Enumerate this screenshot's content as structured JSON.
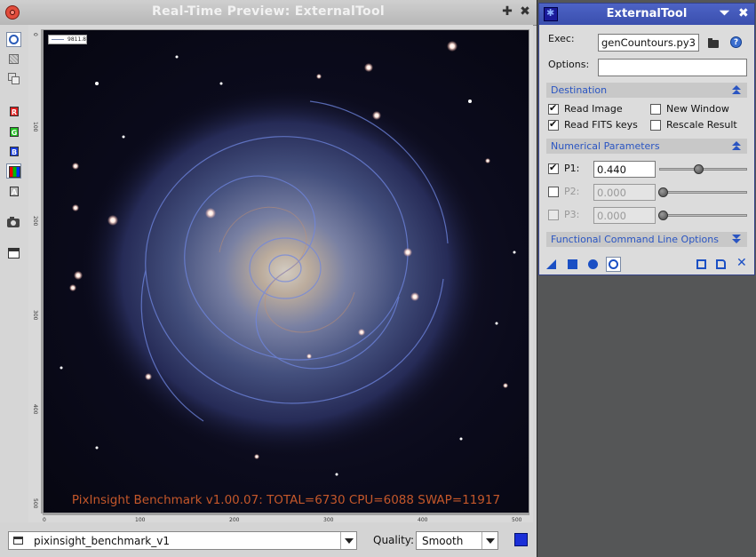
{
  "preview": {
    "title": "Real-Time Preview: ExternalTool",
    "benchmark_text": "PixInsight Benchmark v1.00.07: TOTAL=6730 CPU=6088 SWAP=11917",
    "contour_legend": "9811.8",
    "ruler_left": [
      "0",
      "100",
      "200",
      "300",
      "400",
      "500"
    ],
    "ruler_bottom": [
      "0",
      "100",
      "200",
      "300",
      "400",
      "500"
    ],
    "view_selector": "pixinsight_benchmark_v1",
    "quality_label": "Quality:",
    "quality_value": "Smooth",
    "tools": [
      "readout-mode",
      "zoom-mode",
      "pan-mode",
      "R",
      "G",
      "B",
      "rgb",
      "A",
      "snapshot",
      "new-window"
    ]
  },
  "panel": {
    "title": "ExternalTool",
    "exec_label": "Exec:",
    "exec_value": "genCountours.py3",
    "options_label": "Options:",
    "options_value": "",
    "destination": {
      "title": "Destination",
      "read_image": "Read Image",
      "read_image_checked": true,
      "new_window": "New Window",
      "new_window_checked": false,
      "read_fits": "Read FITS keys",
      "read_fits_checked": true,
      "rescale": "Rescale Result",
      "rescale_checked": false
    },
    "numerical": {
      "title": "Numerical Parameters",
      "p1_label": "P1:",
      "p1_value": "0.440",
      "p1_checked": true,
      "p1_slider": 0.44,
      "p2_label": "P2:",
      "p2_value": "0.000",
      "p2_checked": false,
      "p2_slider": 0.0,
      "p3_label": "P3:",
      "p3_value": "0.000",
      "p3_checked": false,
      "p3_slider": 0.0
    },
    "functional": {
      "title": "Functional Command Line Options"
    }
  },
  "colors": {
    "panel_title_bg": "#4258b8",
    "accent": "#2a55c2",
    "benchmark_text": "#c4572a",
    "contour": "#5a6fd6"
  },
  "icons": [
    "close-icon",
    "plus-icon",
    "x-icon",
    "folder-icon",
    "help-icon",
    "collapse-icon",
    "expand-icon",
    "new-instance-icon",
    "apply-global-icon",
    "apply-icon",
    "real-time-preview-icon",
    "reset-icon",
    "browse-docs-icon",
    "hide-icon"
  ]
}
